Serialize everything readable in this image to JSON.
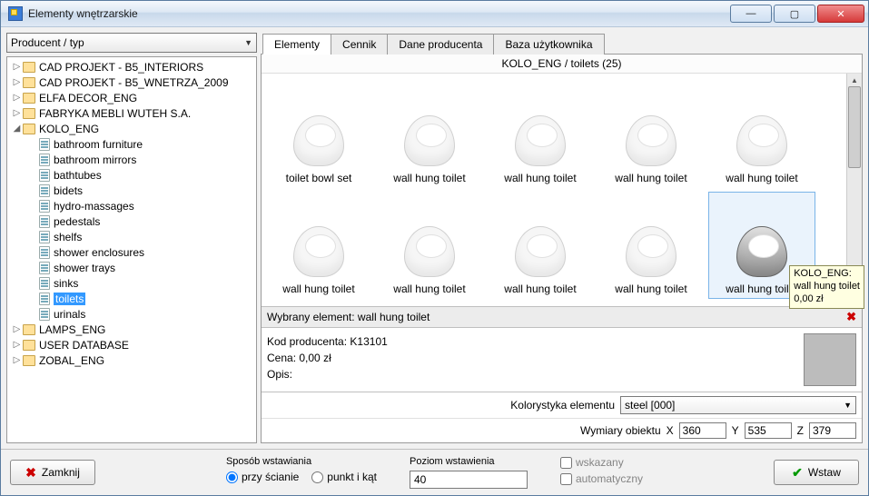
{
  "window": {
    "title": "Elementy wnętrzarskie"
  },
  "sidebar": {
    "combo": "Producent / typ",
    "items": [
      {
        "label": "CAD PROJEKT - B5_INTERIORS",
        "type": "folder",
        "expander": "▷",
        "indent": 0
      },
      {
        "label": "CAD PROJEKT - B5_WNETRZA_2009",
        "type": "folder",
        "expander": "▷",
        "indent": 0
      },
      {
        "label": "ELFA DECOR_ENG",
        "type": "folder",
        "expander": "▷",
        "indent": 0
      },
      {
        "label": "FABRYKA MEBLI WUTEH S.A.",
        "type": "folder",
        "expander": "▷",
        "indent": 0
      },
      {
        "label": "KOLO_ENG",
        "type": "folder",
        "expander": "◢",
        "indent": 0
      },
      {
        "label": "bathroom furniture",
        "type": "file",
        "expander": "",
        "indent": 1
      },
      {
        "label": "bathroom mirrors",
        "type": "file",
        "expander": "",
        "indent": 1
      },
      {
        "label": "bathtubes",
        "type": "file",
        "expander": "",
        "indent": 1
      },
      {
        "label": "bidets",
        "type": "file",
        "expander": "",
        "indent": 1
      },
      {
        "label": "hydro-massages",
        "type": "file",
        "expander": "",
        "indent": 1
      },
      {
        "label": "pedestals",
        "type": "file",
        "expander": "",
        "indent": 1
      },
      {
        "label": "shelfs",
        "type": "file",
        "expander": "",
        "indent": 1
      },
      {
        "label": "shower enclosures",
        "type": "file",
        "expander": "",
        "indent": 1
      },
      {
        "label": "shower trays",
        "type": "file",
        "expander": "",
        "indent": 1
      },
      {
        "label": "sinks",
        "type": "file",
        "expander": "",
        "indent": 1
      },
      {
        "label": "toilets",
        "type": "file",
        "expander": "",
        "indent": 1,
        "selected": true
      },
      {
        "label": "urinals",
        "type": "file",
        "expander": "",
        "indent": 1
      },
      {
        "label": "LAMPS_ENG",
        "type": "folder",
        "expander": "▷",
        "indent": 0
      },
      {
        "label": "USER DATABASE",
        "type": "folder",
        "expander": "▷",
        "indent": 0
      },
      {
        "label": "ZOBAL_ENG",
        "type": "folder",
        "expander": "▷",
        "indent": 0
      }
    ]
  },
  "tabs": [
    "Elementy",
    "Cennik",
    "Dane producenta",
    "Baza użytkownika"
  ],
  "breadcrumb": "KOLO_ENG / toilets (25)",
  "gallery": [
    {
      "label": "toilet bowl set"
    },
    {
      "label": "wall hung toilet"
    },
    {
      "label": "wall hung toilet"
    },
    {
      "label": "wall hung toilet"
    },
    {
      "label": "wall hung toilet"
    },
    {
      "label": "wall hung toilet"
    },
    {
      "label": "wall hung toilet"
    },
    {
      "label": "wall hung toilet"
    },
    {
      "label": "wall hung toilet"
    },
    {
      "label": "wall hung toilet",
      "selected": true,
      "steel": true
    }
  ],
  "tooltip": "KOLO_ENG:\nwall hung toilet\n0,00 zł",
  "selected_bar": "Wybrany element: wall hung toilet",
  "details": {
    "kod_label": "Kod producenta:",
    "kod_value": "K13101",
    "cena_label": "Cena:",
    "cena_value": "0,00 zł",
    "opis_label": "Opis:"
  },
  "color_row": {
    "label": "Kolorystyka elementu",
    "value": "steel [000]"
  },
  "dims": {
    "label": "Wymiary obiektu",
    "x": "360",
    "y": "535",
    "z": "379"
  },
  "footer": {
    "close": "Zamknij",
    "insert": "Wstaw",
    "mode_label": "Sposób wstawiania",
    "mode_a": "przy ścianie",
    "mode_b": "punkt i kąt",
    "level_label": "Poziom wstawienia",
    "level_value": "40",
    "chk_a": "wskazany",
    "chk_b": "automatyczny"
  }
}
